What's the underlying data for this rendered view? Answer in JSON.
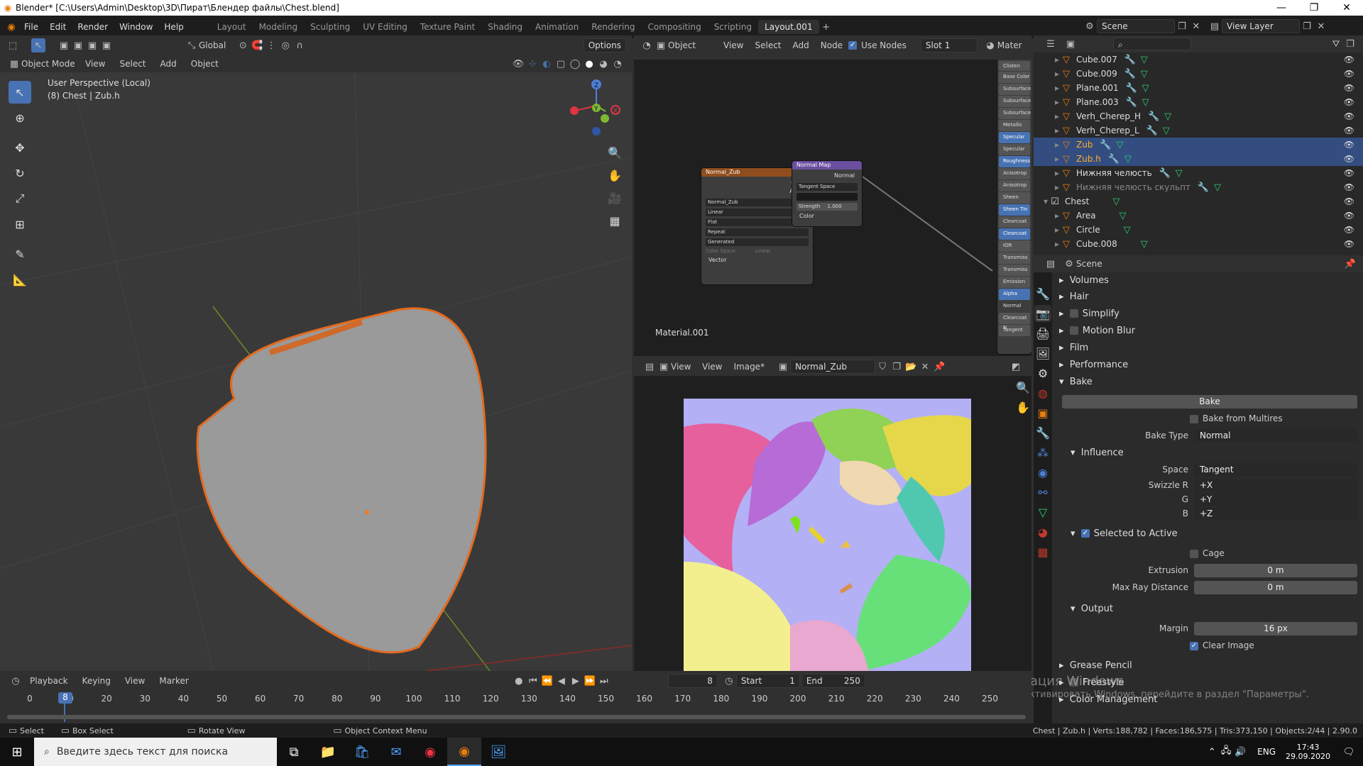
{
  "titlebar": {
    "title": "Blender* [C:\\Users\\Admin\\Desktop\\3D\\Пират\\Блендер файлы\\Chest.blend]"
  },
  "menu": [
    "File",
    "Edit",
    "Render",
    "Window",
    "Help"
  ],
  "workspaces": [
    "Layout",
    "Modeling",
    "Sculpting",
    "UV Editing",
    "Texture Paint",
    "Shading",
    "Animation",
    "Rendering",
    "Compositing",
    "Scripting",
    "Layout.001"
  ],
  "topright": {
    "scene": "Scene",
    "view_layer": "View Layer"
  },
  "viewport": {
    "mode": "Object Mode",
    "menus": [
      "View",
      "Select",
      "Add",
      "Object"
    ],
    "orientation": "Global",
    "options": "Options",
    "overlay_line1": "User Perspective (Local)",
    "overlay_line2": "(8) Chest | Zub.h",
    "gizmo": {
      "x": "X",
      "y": "Y",
      "z": "Z"
    }
  },
  "node_editor": {
    "type": "Object",
    "menus": [
      "View",
      "Select",
      "Add",
      "Node"
    ],
    "use_nodes": "Use Nodes",
    "slot": "Slot 1",
    "material": "Mater",
    "material_label": "Material.001",
    "tex_node": {
      "title": "Normal_Zub",
      "out1": "Color",
      "out2": "Alpha",
      "image": "Normal_Zub",
      "interp": "Linear",
      "proj": "Flat",
      "ext": "Repeat",
      "source": "Generated",
      "cs_label": "Color Space",
      "cs_val": "Linear",
      "vector": "Vector"
    },
    "nmap_node": {
      "title": "Normal Map",
      "out": "Normal",
      "space": "Tangent Space",
      "strength_label": "Strength",
      "strength": "1.000",
      "color": "Color"
    },
    "bsdf_inputs": [
      "Clisten",
      "Base Color",
      "Subsurface",
      "Subsurface",
      "Subsurface",
      "Metallic",
      "Specular",
      "Specular",
      "Roughness",
      "Anisotrop",
      "Anisotrop",
      "Sheen",
      "Sheen Tin",
      "Clearcoat",
      "Clearcoat",
      "IOR",
      "Transmiss",
      "Transmiss",
      "Emission",
      "Alpha",
      "Normal",
      "Clearcoat N",
      "Tangent"
    ]
  },
  "image_editor": {
    "menus": [
      "View",
      "View",
      "Image*"
    ],
    "image": "Normal_Zub"
  },
  "outliner": {
    "rows": [
      {
        "name": "Cube.007",
        "sel": false
      },
      {
        "name": "Cube.009",
        "sel": false
      },
      {
        "name": "Plane.001",
        "sel": false
      },
      {
        "name": "Plane.003",
        "sel": false
      },
      {
        "name": "Verh_Cherep_H",
        "sel": false
      },
      {
        "name": "Verh_Cherep_L",
        "sel": false
      },
      {
        "name": "Zub",
        "sel": true
      },
      {
        "name": "Zub.h",
        "sel": true
      },
      {
        "name": "Нижняя челюсть",
        "sel": false
      },
      {
        "name": "Нижняя челюсть скульпт",
        "sel": false
      },
      {
        "name": "Chest",
        "sel": false
      },
      {
        "name": "Area",
        "sel": false
      },
      {
        "name": "Circle",
        "sel": false
      },
      {
        "name": "Cube.008",
        "sel": false
      }
    ]
  },
  "properties": {
    "context": "Scene",
    "sections": [
      "Volumes",
      "Hair",
      "Simplify",
      "Motion Blur",
      "Film",
      "Performance",
      "Bake"
    ],
    "bake_button": "Bake",
    "bake_from_multires": "Bake from Multires",
    "bake_type_label": "Bake Type",
    "bake_type": "Normal",
    "influence": "Influence",
    "space_label": "Space",
    "space": "Tangent",
    "swizzle": [
      {
        "label": "Swizzle R",
        "val": "+X"
      },
      {
        "label": "G",
        "val": "+Y"
      },
      {
        "label": "B",
        "val": "+Z"
      }
    ],
    "selected_to_active": "Selected to Active",
    "cage": "Cage",
    "extrusion_label": "Extrusion",
    "extrusion": "0 m",
    "max_ray_label": "Max Ray Distance",
    "max_ray": "0 m",
    "output": "Output",
    "margin_label": "Margin",
    "margin": "16 px",
    "clear_image": "Clear Image",
    "more": [
      "Grease Pencil",
      "Freestyle",
      "Color Management"
    ],
    "watermark1": "Активация Windows",
    "watermark2": "Чтобы активировать Windows, перейдите в раздел \"Параметры\"."
  },
  "timeline": {
    "menus": [
      "Playback",
      "Keying",
      "View",
      "Marker"
    ],
    "current": "8",
    "start_label": "Start",
    "start": "1",
    "end_label": "End",
    "end": "250",
    "ticks": [
      "0",
      "10",
      "20",
      "30",
      "40",
      "50",
      "60",
      "70",
      "80",
      "90",
      "100",
      "110",
      "120",
      "130",
      "140",
      "150",
      "160",
      "170",
      "180",
      "190",
      "200",
      "210",
      "220",
      "230",
      "240",
      "250"
    ]
  },
  "statusbar": {
    "select": "Select",
    "box_select": "Box Select",
    "rotate": "Rotate View",
    "context_menu": "Object Context Menu",
    "stats": "Chest | Zub.h | Verts:188,782 | Faces:186,575 | Tris:373,150 | Objects:2/44 | 2.90.0"
  },
  "taskbar": {
    "search": "Введите здесь текст для поиска",
    "lang": "ENG",
    "time": "17:43",
    "date": "29.09.2020"
  }
}
